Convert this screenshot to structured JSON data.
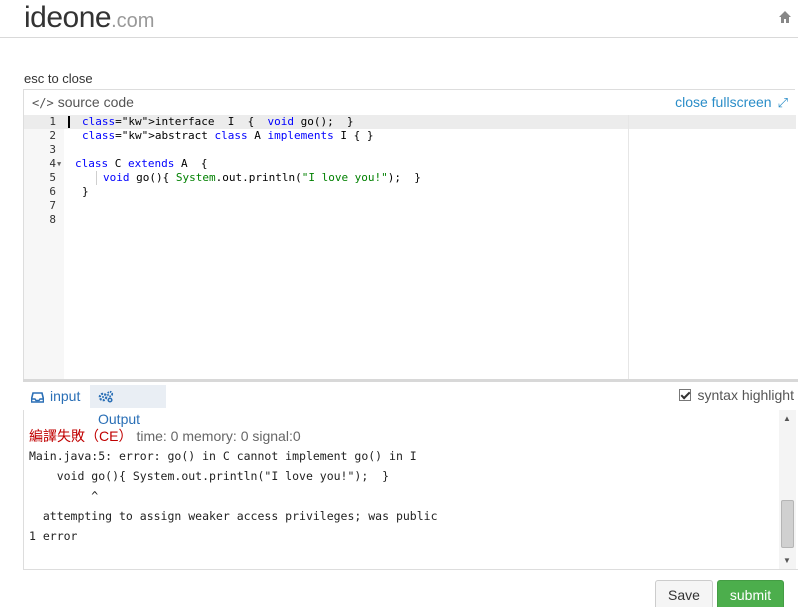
{
  "header": {
    "logo_main": "ideone",
    "logo_tld": ".com",
    "home_icon": "home-icon"
  },
  "esc_hint": "esc to close",
  "editor_panel": {
    "title": "source code",
    "title_icon": "code-icon",
    "close_fullscreen": "close fullscreen",
    "expand_icon": "expand-icon"
  },
  "editor": {
    "active_line": 1,
    "lines": [
      {
        "n": "1",
        "code": "interface  I  {  void go();  }"
      },
      {
        "n": "2",
        "code": "abstract class A implements I { }"
      },
      {
        "n": "3",
        "code": ""
      },
      {
        "n": "4",
        "code": "class C extends A  {",
        "fold": true
      },
      {
        "n": "5",
        "code": "void go(){ System.out.println(\"I love you!\");  }"
      },
      {
        "n": "6",
        "code": "}"
      },
      {
        "n": "7",
        "code": ""
      },
      {
        "n": "8",
        "code": ""
      }
    ]
  },
  "io_tabs": {
    "input": "input",
    "output": "Output",
    "active": "output",
    "syntax_highlight_label": "syntax highlight",
    "syntax_highlight_checked": true
  },
  "output": {
    "status": "編譯失敗（CE）",
    "meta": "time: 0 memory: 0 signal:0",
    "text": "Main.java:5: error: go() in C cannot implement go() in I\n    void go(){ System.out.println(\"I love you!\");  }\n         ^\n  attempting to assign weaker access privileges; was public\n1 error"
  },
  "buttons": {
    "save": "Save",
    "submit": "submit"
  },
  "colors": {
    "link": "#2a8dc8",
    "submit_bg": "#4cae4c",
    "error": "#c00000",
    "keyword": "#0000ff",
    "string": "#008000"
  }
}
